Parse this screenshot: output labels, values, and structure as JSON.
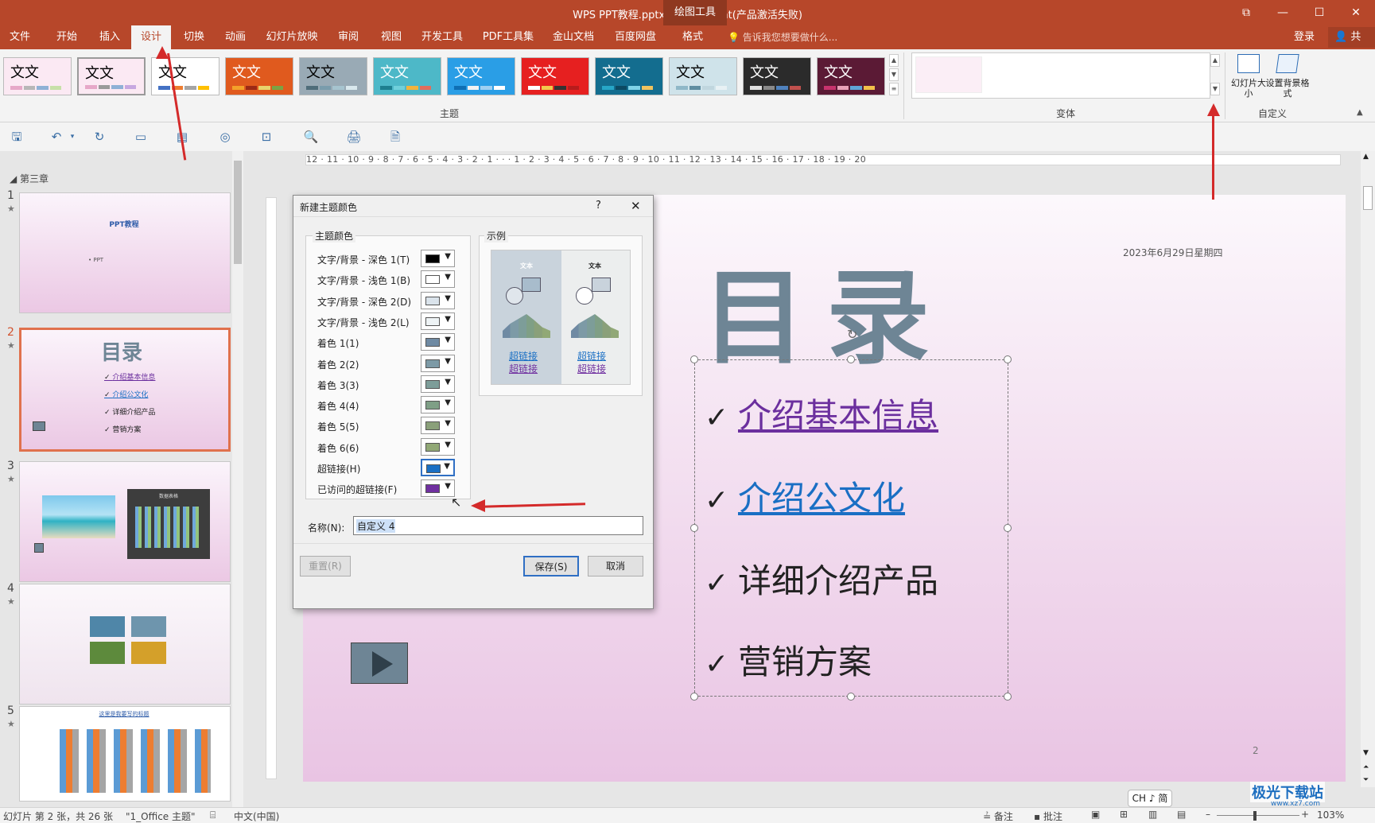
{
  "window": {
    "title": "WPS PPT教程.pptx - PowerPoint(产品激活失败)",
    "context_tool": "绘图工具",
    "controls": [
      "⧉",
      "—",
      "☐",
      "✕"
    ]
  },
  "menu": {
    "tabs": [
      "文件",
      "开始",
      "插入",
      "设计",
      "切换",
      "动画",
      "幻灯片放映",
      "审阅",
      "视图",
      "开发工具",
      "PDF工具集",
      "金山文档",
      "百度网盘",
      "格式"
    ],
    "active": "设计",
    "tell_me": "告诉我您想要做什么...",
    "login": "登录",
    "share": "共享"
  },
  "ribbon": {
    "theme_sample_text": "文文",
    "themes_label": "主题",
    "variants_label": "变体",
    "custom_label": "自定义",
    "slide_size_label": "幻灯片大小",
    "format_bg_label": "设置背景格式",
    "themes": [
      {
        "bg": "#fbe9f3",
        "fg": "#000000",
        "bars": [
          "#e6a8c8",
          "#b7b7b7",
          "#8fb1d6",
          "#c7e0a8"
        ]
      },
      {
        "bg": "#fbe9f3",
        "fg": "#000000",
        "bars": [
          "#e6a8c8",
          "#9a9a9a",
          "#8fb1d6",
          "#c7a8e0"
        ]
      },
      {
        "bg": "#ffffff",
        "fg": "#000000",
        "bars": [
          "#4472c4",
          "#ed7d31",
          "#a5a5a5",
          "#ffc000"
        ]
      },
      {
        "bg": "#e05a1e",
        "fg": "#ffffff",
        "bars": [
          "#f4a12a",
          "#9b2a16",
          "#e8d36c",
          "#7ba344"
        ]
      },
      {
        "bg": "#99aab5",
        "fg": "#000000",
        "bars": [
          "#4f6d7a",
          "#7a9cac",
          "#a6c4cf",
          "#d9e8ed"
        ]
      },
      {
        "bg": "#4db8c8",
        "fg": "#ffffff",
        "bars": [
          "#1e7f8f",
          "#6fd0db",
          "#f2b33d",
          "#e26d5c"
        ]
      },
      {
        "bg": "#2a9ee6",
        "fg": "#ffffff",
        "bars": [
          "#0f6fb4",
          "#f2f2f2",
          "#9fd0f2",
          "#ffffff"
        ]
      },
      {
        "bg": "#e62020",
        "fg": "#ffffff",
        "bars": [
          "#ffffff",
          "#f2c94c",
          "#333333",
          "#b71c1c"
        ]
      },
      {
        "bg": "#136d8f",
        "fg": "#ffffff",
        "bars": [
          "#27a6c7",
          "#0c4a63",
          "#7fd3e8",
          "#f0c35e"
        ]
      },
      {
        "bg": "#cfe3ea",
        "fg": "#000000",
        "bars": [
          "#8fb8c8",
          "#5f8ea1",
          "#c0d6de",
          "#e8f1f4"
        ]
      },
      {
        "bg": "#2b2b2b",
        "fg": "#ffffff",
        "bars": [
          "#e0e0e0",
          "#8a8a8a",
          "#4f81bd",
          "#c0504d"
        ]
      },
      {
        "bg": "#5b1a35",
        "fg": "#ffffff",
        "bars": [
          "#c7336d",
          "#e8a1b8",
          "#5fa5d6",
          "#f2c04a"
        ]
      }
    ]
  },
  "panel": {
    "section": "第三章",
    "thumbs": [
      {
        "num": "1",
        "title": "PPT教程",
        "line": "• PPT"
      },
      {
        "num": "2",
        "title": "目录",
        "items": [
          "介绍基本信息",
          "介绍公文化",
          "详细介绍产品",
          "营销方案"
        ]
      },
      {
        "num": "3",
        "chart_title": "数据表格"
      },
      {
        "num": "4"
      },
      {
        "num": "5",
        "title": "这里是我要写的标题"
      }
    ]
  },
  "slide": {
    "title": "目录",
    "date": "2023年6月29日星期四",
    "bullets": [
      "介绍基本信息",
      "介绍公文化",
      "详细介绍产品",
      "营销方案"
    ],
    "page_number": "2"
  },
  "dialog": {
    "title": "新建主题颜色",
    "help": "?",
    "close": "✕",
    "theme_colors_legend": "主题颜色",
    "sample_legend": "示例",
    "rows": [
      {
        "label": "文字/背景 - 深色 1(T)",
        "color": "#000000"
      },
      {
        "label": "文字/背景 - 浅色 1(B)",
        "color": "#ffffff"
      },
      {
        "label": "文字/背景 - 深色 2(D)",
        "color": "#dae3eb"
      },
      {
        "label": "文字/背景 - 浅色 2(L)",
        "color": "#eef3f5"
      },
      {
        "label": "着色 1(1)",
        "color": "#6f8aa3"
      },
      {
        "label": "着色 2(2)",
        "color": "#7d9aa6"
      },
      {
        "label": "着色 3(3)",
        "color": "#7d9d99"
      },
      {
        "label": "着色 4(4)",
        "color": "#7f9f86"
      },
      {
        "label": "着色 5(5)",
        "color": "#8aa07a"
      },
      {
        "label": "着色 6(6)",
        "color": "#91a876"
      },
      {
        "label": "超链接(H)",
        "color": "#1a6fc4"
      },
      {
        "label": "已访问的超链接(F)",
        "color": "#7030a0"
      }
    ],
    "sample_text": "文本",
    "sample_link": "超链接",
    "name_label": "名称(N):",
    "name_value": "自定义 4",
    "reset_label": "重置(R)",
    "save_label": "保存(S)",
    "cancel_label": "取消"
  },
  "ruler": {
    "h_ticks": "12 · 11 · 10 · 9 · 8 · 7 · 6 · 5 · 4 · 3 · 2 · 1 · · · 1 · 2 · 3 · 4 · 5 · 6 · 7 · 8 · 9 · 10 · 11 · 12 · 13 · 14 · 15 · 16 · 17 · 18 · 19 · 20"
  },
  "status": {
    "slide_info": "幻灯片 第 2 张，共 26 张",
    "theme": "\"1_Office 主题\"",
    "language": "中文(中国)",
    "notes": "备注",
    "comments": "批注",
    "zoom": "103%",
    "ime": "CH ♪ 简",
    "watermark": "极光下载站",
    "watermark_url": "www.xz7.com"
  }
}
